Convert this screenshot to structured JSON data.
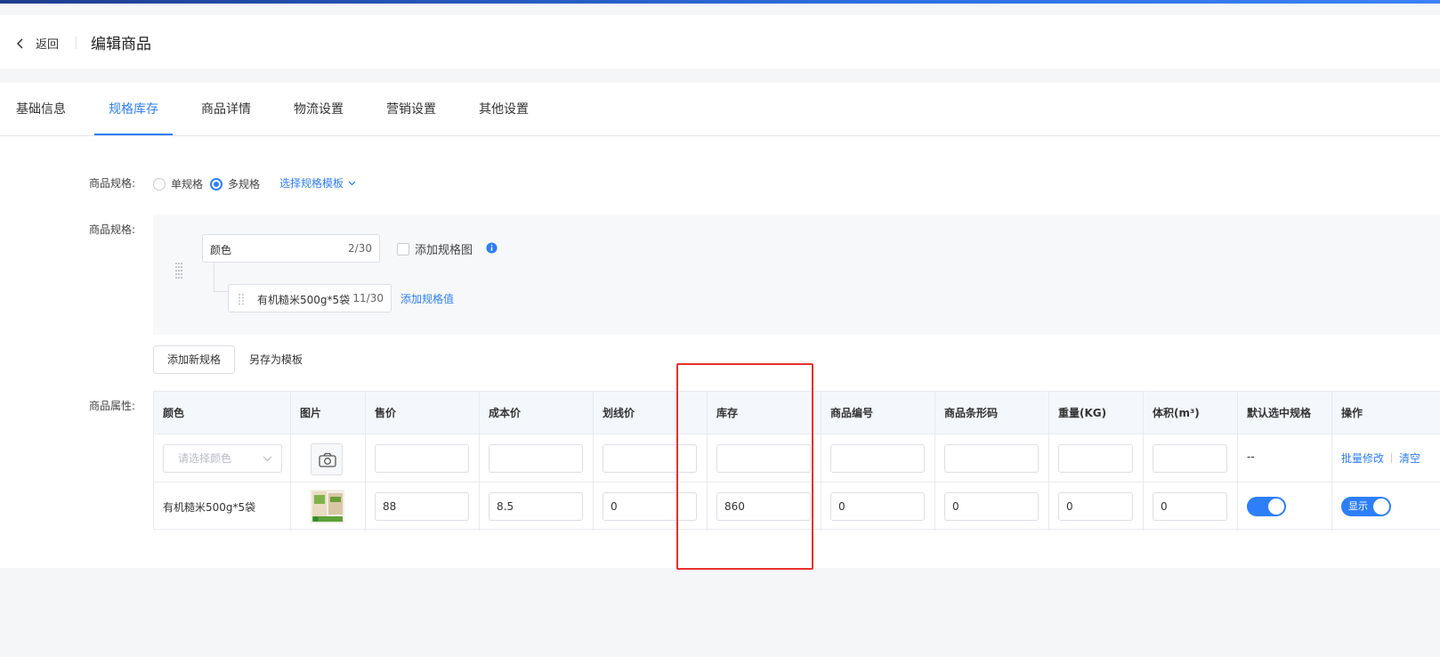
{
  "header": {
    "back_label": "返回",
    "title": "编辑商品"
  },
  "tabs": [
    {
      "label": "基础信息",
      "active": false
    },
    {
      "label": "规格库存",
      "active": true
    },
    {
      "label": "商品详情",
      "active": false
    },
    {
      "label": "物流设置",
      "active": false
    },
    {
      "label": "营销设置",
      "active": false
    },
    {
      "label": "其他设置",
      "active": false
    }
  ],
  "spec_type": {
    "label": "商品规格:",
    "single_label": "单规格",
    "multi_label": "多规格",
    "selected": "多规格",
    "template_link": "选择规格模板"
  },
  "spec_editor": {
    "label": "商品规格:",
    "name_value": "颜色",
    "name_count": "2/30",
    "add_image_label": "添加规格图",
    "value_text": "有机糙米500g*5袋",
    "value_count": "11/30",
    "add_value_link": "添加规格值"
  },
  "actions": {
    "add_spec_button": "添加新规格",
    "save_template_button": "另存为模板"
  },
  "attributes": {
    "label": "商品属性:",
    "columns": [
      "颜色",
      "图片",
      "售价",
      "成本价",
      "划线价",
      "库存",
      "商品编号",
      "商品条形码",
      "重量(KG)",
      "体积(m³)",
      "默认选中规格",
      "操作"
    ],
    "batch_row": {
      "color_placeholder": "请选择颜色",
      "default_text": "--",
      "batch_edit_link": "批量修改",
      "clear_link": "清空"
    },
    "rows": [
      {
        "color": "有机糙米500g*5袋",
        "price": "88",
        "cost": "8.5",
        "original_price": "0",
        "stock": "860",
        "code": "0",
        "barcode": "0",
        "weight": "0",
        "volume": "0",
        "default_selected": true,
        "show_label": "显示"
      }
    ]
  },
  "colors": {
    "accent": "#2d7ff9",
    "highlight": "#e8302b"
  }
}
